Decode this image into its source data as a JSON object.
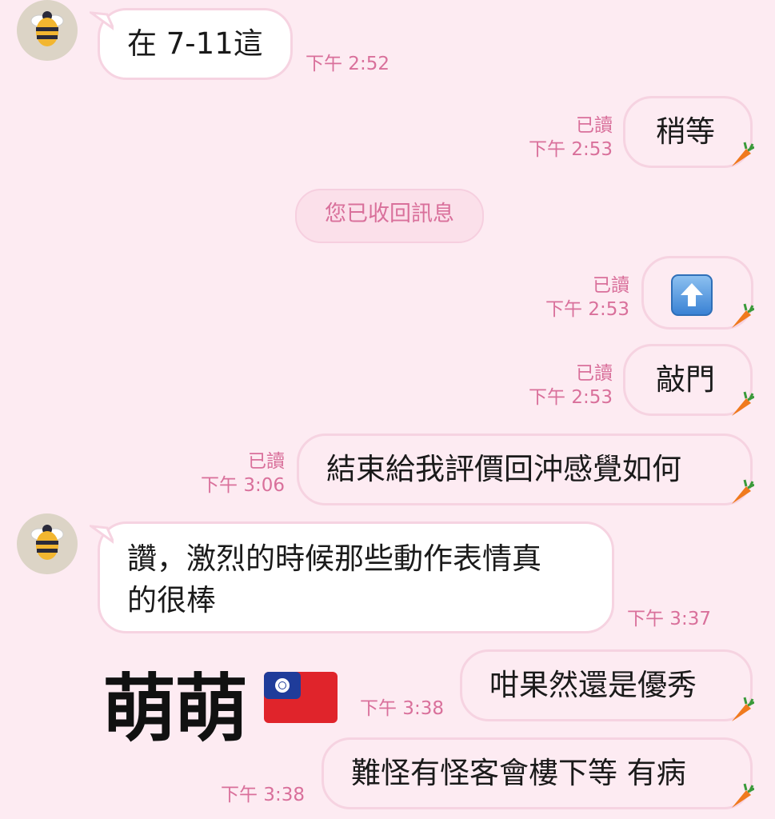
{
  "messages": [
    {
      "id": "m1",
      "side": "in",
      "text": "在 7-11這",
      "time": "下午 2:52"
    },
    {
      "id": "m2",
      "side": "out",
      "text": "稍等",
      "read": "已讀",
      "time": "下午 2:53"
    },
    {
      "id": "sys1",
      "side": "system",
      "text": "您已收回訊息"
    },
    {
      "id": "m3",
      "side": "out",
      "icon": "up-arrow-button-icon",
      "read": "已讀",
      "time": "下午 2:53"
    },
    {
      "id": "m4",
      "side": "out",
      "text": "敲門",
      "read": "已讀",
      "time": "下午 2:53"
    },
    {
      "id": "m5",
      "side": "out",
      "text": "結束給我評價回沖感覺如何",
      "read": "已讀",
      "time": "下午 3:06"
    },
    {
      "id": "m6",
      "side": "in",
      "line1": "讚，激烈的時候那些動作表情真",
      "line2": "的很棒",
      "time": "下午 3:37"
    },
    {
      "id": "m7",
      "side": "out",
      "text": "咁果然還是優秀",
      "time": "下午 3:38"
    },
    {
      "id": "m8",
      "side": "out",
      "text": "難怪有怪客會樓下等 有病",
      "time": "下午 3:38"
    }
  ],
  "overlay": {
    "text": "萌萌",
    "flag_icon": "taiwan-flag-icon"
  },
  "colors": {
    "background": "#fdebf2",
    "accent": "#d9709b",
    "bubble_border": "#f6d3e1"
  }
}
